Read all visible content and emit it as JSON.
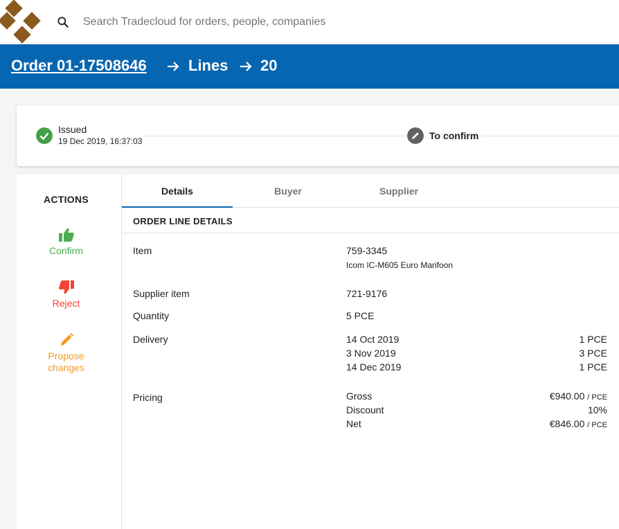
{
  "colors": {
    "brand_blue": "#0766b1",
    "logo_brown": "#8a5a1e",
    "issued_green": "#43a047",
    "confirm_green": "#4caf50",
    "reject_red": "#f44336",
    "propose_orange": "#f79a1e",
    "step_grey": "#616161"
  },
  "search": {
    "placeholder": "Search Tradecloud for orders, people, companies",
    "icon": "search-icon"
  },
  "breadcrumb": {
    "order": "Order 01-17508646",
    "lines": "Lines",
    "line_number": "20"
  },
  "status": {
    "step1": {
      "title": "Issued",
      "date": "19 Dec 2019, 16:37:03",
      "icon": "check-icon"
    },
    "step2": {
      "title": "To confirm",
      "icon": "pencil-icon"
    }
  },
  "actions": {
    "title": "ACTIONS",
    "confirm": {
      "label": "Confirm",
      "icon": "thumbs-up-icon"
    },
    "reject": {
      "label": "Reject",
      "icon": "thumbs-down-icon"
    },
    "propose": {
      "line1": "Propose",
      "line2": "changes",
      "icon": "pencil-icon"
    }
  },
  "tabs": [
    "Details",
    "Buyer",
    "Supplier"
  ],
  "details": {
    "section_title": "ORDER LINE DETAILS",
    "item": {
      "label": "Item",
      "code": "759-3345",
      "description": "Icom IC-M605 Euro Marifoon"
    },
    "supplier_item": {
      "label": "Supplier item",
      "value": "721-9176"
    },
    "quantity": {
      "label": "Quantity",
      "value": "5 PCE"
    },
    "delivery": {
      "label": "Delivery",
      "rows": [
        {
          "date": "14 Oct 2019",
          "qty": "1 PCE"
        },
        {
          "date": "3 Nov 2019",
          "qty": "3 PCE"
        },
        {
          "date": "14 Dec 2019",
          "qty": "1 PCE"
        }
      ]
    },
    "pricing": {
      "label": "Pricing",
      "gross": {
        "label": "Gross",
        "value": "€940.00",
        "unit": "/ PCE"
      },
      "discount": {
        "label": "Discount",
        "value": "10%"
      },
      "net": {
        "label": "Net",
        "value": "€846.00",
        "unit": "/ PCE"
      }
    }
  }
}
